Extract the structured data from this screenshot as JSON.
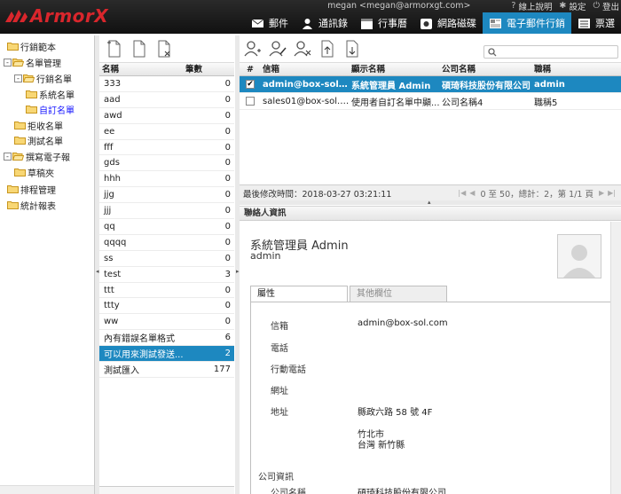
{
  "app": {
    "brand": "ArmorX",
    "user_email": "megan <megan@armorxgt.com>",
    "top_links": [
      {
        "label": "線上說明",
        "icon": "help-icon"
      },
      {
        "label": "設定",
        "icon": "gear-icon"
      },
      {
        "label": "登出",
        "icon": "power-icon"
      }
    ],
    "nav": [
      {
        "label": "郵件",
        "icon": "envelope-icon",
        "active": false
      },
      {
        "label": "通訊錄",
        "icon": "person-icon",
        "active": false
      },
      {
        "label": "行事曆",
        "icon": "calendar-icon",
        "active": false
      },
      {
        "label": "網路磁碟",
        "icon": "disk-icon",
        "active": false
      },
      {
        "label": "電子郵件行銷",
        "icon": "newsletter-icon",
        "active": true
      },
      {
        "label": "票選",
        "icon": "poll-icon",
        "active": false
      }
    ],
    "accent": "#1d88c0"
  },
  "tree": {
    "nodes": [
      {
        "label": "行銷範本",
        "level": 0,
        "expander": "",
        "selected": false
      },
      {
        "label": "名單管理",
        "level": 0,
        "expander": "-",
        "selected": false
      },
      {
        "label": "行銷名單",
        "level": 1,
        "expander": "-",
        "selected": false
      },
      {
        "label": "系統名單",
        "level": 2,
        "expander": "",
        "selected": false
      },
      {
        "label": "自訂名單",
        "level": 2,
        "expander": "",
        "selected": true
      },
      {
        "label": "拒收名單",
        "level": 1,
        "expander": "",
        "selected": false
      },
      {
        "label": "測試名單",
        "level": 1,
        "expander": "",
        "selected": false
      },
      {
        "label": "撰寫電子報",
        "level": 0,
        "expander": "-",
        "selected": false
      },
      {
        "label": "草稿夾",
        "level": 1,
        "expander": "",
        "selected": false
      },
      {
        "label": "排程管理",
        "level": 0,
        "expander": "",
        "selected": false
      },
      {
        "label": "統計報表",
        "level": 0,
        "expander": "",
        "selected": false
      }
    ]
  },
  "list": {
    "toolbar": [
      "add-list-icon",
      "edit-list-icon",
      "delete-list-icon"
    ],
    "headers": {
      "name": "名稱",
      "count": "筆數"
    },
    "rows": [
      {
        "name": "333",
        "count": "0"
      },
      {
        "name": "aad",
        "count": "0"
      },
      {
        "name": "awd",
        "count": "0"
      },
      {
        "name": "ee",
        "count": "0"
      },
      {
        "name": "fff",
        "count": "0"
      },
      {
        "name": "gds",
        "count": "0"
      },
      {
        "name": "hhh",
        "count": "0"
      },
      {
        "name": "jjg",
        "count": "0"
      },
      {
        "name": "jjj",
        "count": "0"
      },
      {
        "name": "qq",
        "count": "0"
      },
      {
        "name": "qqqq",
        "count": "0"
      },
      {
        "name": "ss",
        "count": "0"
      },
      {
        "name": "test",
        "count": "3"
      },
      {
        "name": "ttt",
        "count": "0"
      },
      {
        "name": "ttty",
        "count": "0"
      },
      {
        "name": "ww",
        "count": "0"
      },
      {
        "name": "內有錯誤名單格式",
        "count": "6"
      },
      {
        "name": "可以用來測試發送...",
        "count": "2",
        "selected": true
      },
      {
        "name": "測試匯入",
        "count": "177"
      }
    ]
  },
  "contacts": {
    "toolbar": [
      "add-contact-icon",
      "edit-contact-icon",
      "delete-contact-icon",
      "import-icon",
      "export-icon"
    ],
    "headers": {
      "hash": "#",
      "email": "信箱",
      "display_name": "顯示名稱",
      "company": "公司名稱",
      "title": "職稱"
    },
    "rows": [
      {
        "checked": true,
        "email": "admin@box-sol.com",
        "display_name": "系統管理員 Admin",
        "company": "碩琦科技股份有限公司",
        "title": "admin",
        "selected": true
      },
      {
        "checked": false,
        "email": "sales01@box-sol.c...",
        "display_name": "使用者自訂名單中顯...",
        "company": "公司名稱4",
        "title": "職稱5",
        "selected": false
      }
    ],
    "status": {
      "last_modified": "最後修改時間：2018-03-27 03:21:11",
      "pager": "0 至 50，總計：2，第 1/1 頁"
    }
  },
  "detail": {
    "panel_title": "聯絡人資訊",
    "name": "系統管理員 Admin",
    "sub": "admin",
    "tabs": [
      "屬性",
      "其他欄位"
    ],
    "fields": [
      {
        "label": "信箱",
        "value": "admin@box-sol.com"
      },
      {
        "label": "電話",
        "value": ""
      },
      {
        "label": "行動電話",
        "value": ""
      },
      {
        "label": "網址",
        "value": ""
      },
      {
        "label": "地址",
        "value": "縣政六路 58 號 4F"
      }
    ],
    "address_extra": [
      "竹北市",
      "台灣 新竹縣"
    ],
    "company_section": "公司資訊",
    "company_label": "公司名稱",
    "company_value": "碩琦科技股份有限公司"
  }
}
